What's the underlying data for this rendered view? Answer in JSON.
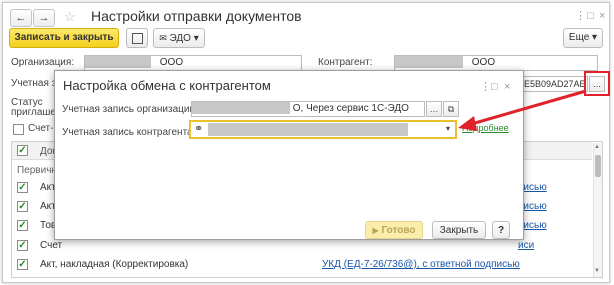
{
  "window": {
    "title": "Настройки отправки документов",
    "back_icon": "arrow-left",
    "forward_icon": "arrow-right",
    "star_icon": "star",
    "menu_icon": "more-vertical",
    "maximize_icon": "maximize",
    "close_icon": "close"
  },
  "toolbar": {
    "save_close_label": "Записать и закрыть",
    "edo_label": "ЭДО",
    "more_label": "Еще"
  },
  "form": {
    "org_label": "Организация:",
    "org_value": "ООО",
    "contr_label": "Контрагент:",
    "contr_value": "ООО",
    "account_label": "Учетная за",
    "account_value_tail": "E5B09AD27AE",
    "select_btn_label": "...",
    "status_label": "Статус",
    "status_label2": "приглашени",
    "invoice_label": "Счет-ф"
  },
  "table": {
    "header_col1": "Док",
    "group_label": "Первичн",
    "rows": [
      {
        "label": "Акт",
        "link": "писью"
      },
      {
        "label": "Акт",
        "link": "писью"
      },
      {
        "label": "Това",
        "link": "писью"
      },
      {
        "label": "Счет",
        "link": "иси"
      },
      {
        "label": "Акт, накладная (Корректировка)",
        "link": "УКД (ЕД-7-26/736@), с ответной подписью"
      }
    ]
  },
  "dialog": {
    "title": "Настройка обмена с контрагентом",
    "org_account_label": "Учетная запись организации:",
    "org_account_value": "О, Через сервис 1С-ЭДО",
    "contr_account_label": "Учетная запись контрагента:",
    "details_link": "Подробнее",
    "ok_label": "Готово",
    "close_label": "Закрыть",
    "help_label": "?"
  },
  "colors": {
    "primary_button": "#f4cf1c",
    "highlight_border": "#e8c030",
    "red_marker": "#e0232b",
    "link": "#1a56a8"
  }
}
